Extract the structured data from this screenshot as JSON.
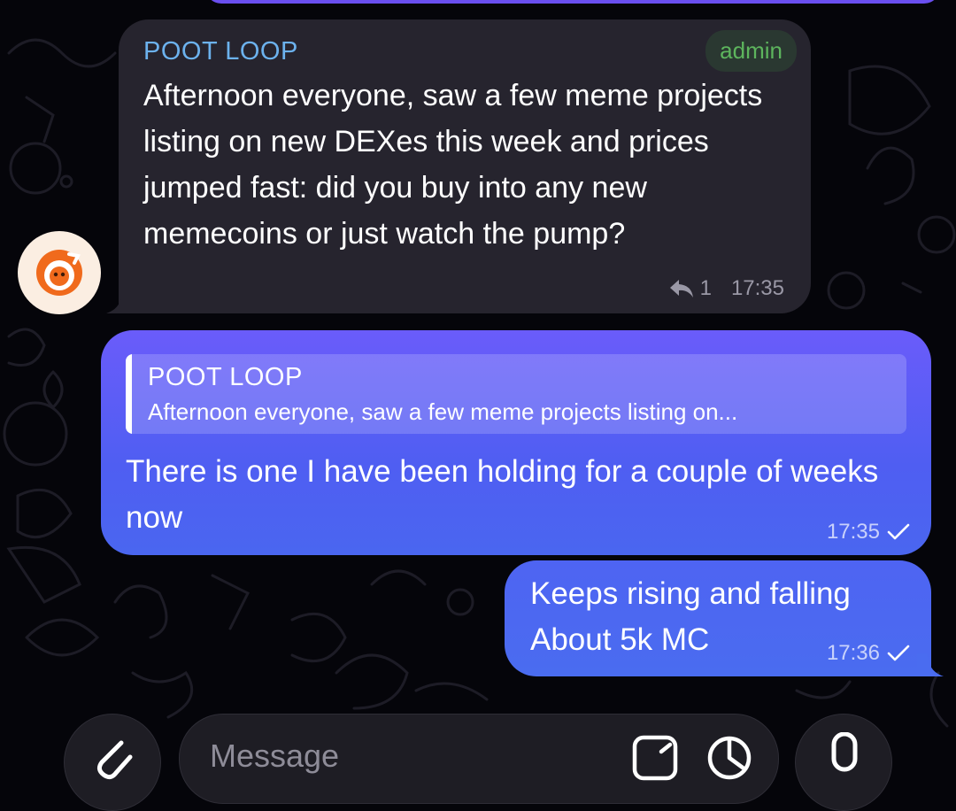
{
  "colors": {
    "background": "#05050a",
    "incoming_bubble": "#26242e",
    "outgoing_bubble": "#5060f2",
    "sender_name": "#6cb2ee",
    "admin_badge": "#5db55d"
  },
  "messages": [
    {
      "direction": "incoming",
      "sender": "POOT LOOP",
      "badge": "admin",
      "text": "Afternoon everyone, saw a few meme projects listing on new DEXes this week and prices jumped fast: did you buy into any new memecoins or just watch the pump?",
      "reply_count": "1",
      "time": "17:35",
      "avatar_icon": "orange-mascot-icon"
    },
    {
      "direction": "outgoing",
      "quote": {
        "sender": "POOT LOOP",
        "text": "Afternoon everyone, saw a few meme projects listing on..."
      },
      "text": "There is one I have been holding for a couple of weeks now",
      "time": "17:35",
      "status_icon": "check-icon"
    },
    {
      "direction": "outgoing",
      "text": "Keeps rising and falling\nAbout 5k MC",
      "line1": "Keeps rising and falling",
      "line2": "About 5k MC",
      "time": "17:36",
      "status_icon": "check-icon"
    }
  ],
  "composer": {
    "placeholder": "Message",
    "attach_icon": "paperclip-icon",
    "sticker_icon": "sticker-icon",
    "timer_icon": "clock-icon",
    "mic_icon": "microphone-icon"
  }
}
